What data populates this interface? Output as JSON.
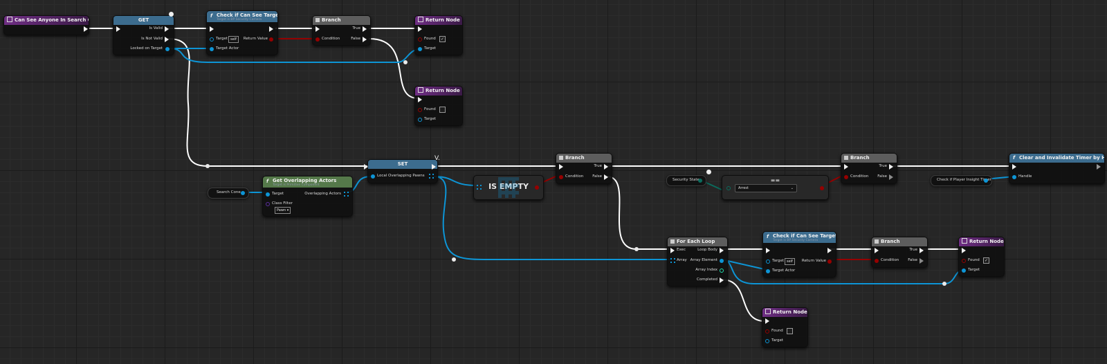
{
  "entry": {
    "title": "Can See Anyone In Search Cone"
  },
  "get_node": {
    "title": "GET",
    "is_valid": "Is Valid",
    "is_not_valid": "Is Not Valid",
    "locked_on_target": "Locked on Target"
  },
  "check_top": {
    "title": "Check if Can See Target",
    "subtitle": "Target is BP Security Camera",
    "target": "Target",
    "self_label": "self",
    "return_value": "Return Value",
    "target_actor": "Target Actor"
  },
  "branch1": {
    "title": "Branch",
    "condition": "Condition",
    "true_label": "True",
    "false_label": "False"
  },
  "return1": {
    "title": "Return Node",
    "found": "Found",
    "target": "Target"
  },
  "return2": {
    "title": "Return Node",
    "found": "Found",
    "target": "Target"
  },
  "search_cone": {
    "label": "Search Cone"
  },
  "get_overlap": {
    "title": "Get Overlapping Actors",
    "subtitle": "Target is Primitive Component",
    "target": "Target",
    "overlapping_actors": "Overlapping Actors",
    "class_filter": "Class Filter",
    "class_value": "Pawn"
  },
  "set_node": {
    "title": "SET",
    "local_overlapping": "Local Overlapping Pawns"
  },
  "is_empty": {
    "title": "IS EMPTY"
  },
  "branch2": {
    "title": "Branch",
    "condition": "Condition",
    "true_label": "True",
    "false_label": "False"
  },
  "security_state": {
    "label": "Security State"
  },
  "equal_node": {
    "title": "==",
    "value": "Arrest"
  },
  "branch3": {
    "title": "Branch",
    "condition": "Condition",
    "true_label": "True",
    "false_label": "False"
  },
  "check_timer": {
    "label": "Check if Player Insight Timer"
  },
  "clear_timer": {
    "title": "Clear and Invalidate Timer by Handle",
    "handle": "Handle"
  },
  "foreach": {
    "title": "For Each Loop",
    "exec": "Exec",
    "loop_body": "Loop Body",
    "array": "Array",
    "array_element": "Array Element",
    "array_index": "Array Index",
    "completed": "Completed"
  },
  "check_bottom": {
    "title": "Check if Can See Target",
    "subtitle": "Target is BP Security Camera",
    "target": "Target",
    "self_label": "self",
    "return_value": "Return Value",
    "target_actor": "Target Actor"
  },
  "branch4": {
    "title": "Branch",
    "condition": "Condition",
    "true_label": "True",
    "false_label": "False"
  },
  "return3": {
    "title": "Return Node",
    "found": "Found",
    "target": "Target"
  },
  "return4": {
    "title": "Return Node",
    "found": "Found",
    "target": "Target"
  },
  "colors": {
    "exec": "#ffffff",
    "object": "#0d95d6",
    "bool": "#960000",
    "byte": "#0b6b5d",
    "header_func": "#3c6c8e",
    "header_return": "#6f2e84",
    "header_branch": "#5d5d5d",
    "header_pure": "#55794a"
  }
}
